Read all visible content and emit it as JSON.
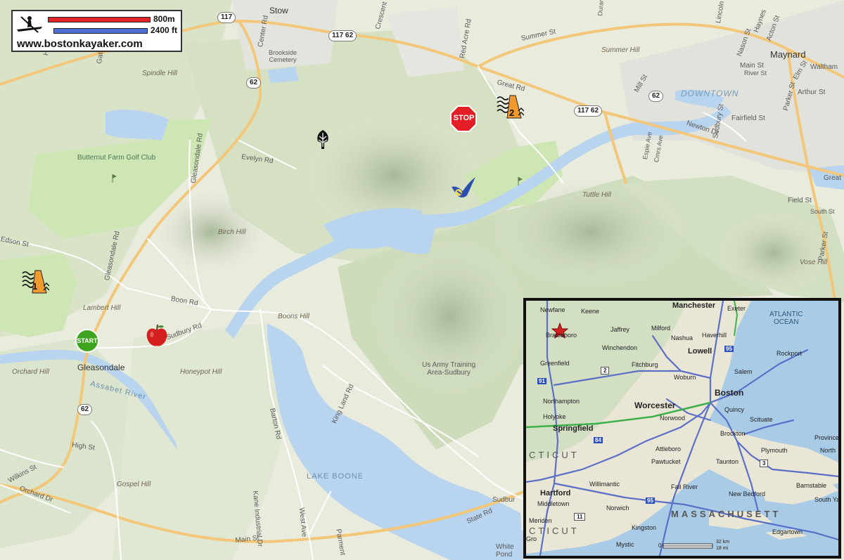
{
  "legend": {
    "scale_metric": "800m",
    "scale_imperial": "2400 ft",
    "website": "www.bostonkayaker.com",
    "kayak_icon": "kayaker-icon",
    "metric_bar_color": "#e0262b",
    "imperial_bar_color": "#4f6ed6"
  },
  "places": {
    "stow": "Stow",
    "maynard": "Maynard",
    "downtown": "DOWNTOWN",
    "gleasondale": "Gleasondale",
    "assabet_river": "Assabet River",
    "lake_boone": "LAKE BOONE",
    "army_area": "Us Army Training\nArea-Sudbury",
    "white_pond": "White\nPond",
    "cemetery": "Brookside\nCemetery",
    "golf_club": "Butternut Farm Golf Club"
  },
  "hills": [
    "Spindle Hill",
    "Summer Hill",
    "Birch Hill",
    "Lambert Hill",
    "Boons Hill",
    "Orchard Hill",
    "Honeypot Hill",
    "Gospel Hill",
    "Tuttle Hill",
    "Vose Hill"
  ],
  "roads": {
    "summer_st": "Summer St",
    "great_rd": "Great Rd",
    "great_rd_east": "Great",
    "red_acre_rd": "Red Acre Rd",
    "crescent_st": "Crescent St",
    "gleasondale_rd_n": "Gleasondale Rd",
    "gleasondale_rd_s": "Gleasondale Rd",
    "evelyn_rd": "Evelyn Rd",
    "edson_st": "Edson St",
    "boon_rd": "Boon Rd",
    "sudbury_rd": "Sudbury Rd",
    "barton_rd": "Barton Rd",
    "king_land_rd": "King Land Rd",
    "kane_industrial_dr": "Kane Industrial Dr",
    "west_ave": "West Ave",
    "parmenter": "Parment",
    "main_st": "Main St",
    "high_st": "High St",
    "wilkins_st": "Wilkins St",
    "orchard_dr": "Orchard Dr",
    "state_rd": "State Rd",
    "sudbury_east": "Sudbur",
    "gates_ln": "Gates Ln",
    "hudson": "Huds",
    "center_rd": "Center Rd",
    "lincoln_st": "Lincoln St",
    "haynes": "Haynes",
    "acton_st": "Acton St",
    "nason_st": "Nason St",
    "main_st_maynard": "Main St",
    "river_st": "River St",
    "waltham": "Waltham",
    "elm_st": "Elm St",
    "arthur_st": "Arthur St",
    "parker_st": "Parker St",
    "parker_st_s": "Parker St",
    "mill_st": "Mill St",
    "newton_dr": "Newton Dr",
    "sudbury_st": "Sudbury St",
    "fairfield_st": "Fairfield St",
    "field_st": "Field St",
    "south_st": "South St",
    "espie_ave": "Espie Ave",
    "concord_st": "Cmrs Ave",
    "durant": "Durant"
  },
  "shields": {
    "r117_top": "117",
    "r117_62": "117 62",
    "r62_a": "62",
    "r62_b": "62",
    "r62_maynard": "62",
    "r117_62_east": "117 62"
  },
  "markers": {
    "start_label": "START",
    "stop_label": "STOP",
    "launch1_label": "1",
    "launch2_label": "2"
  },
  "inset": {
    "cities": [
      "Manchester",
      "Keene",
      "Exeter",
      "Jaffrey",
      "Milford",
      "Haverhill",
      "Newfane",
      "Brattleboro",
      "Nashua",
      "Winchendon",
      "Lowell",
      "Rockport",
      "Greenfield",
      "Fitchburg",
      "Salem",
      "Woburn",
      "Boston",
      "Northampton",
      "Worcester",
      "Quincy",
      "Holyoke",
      "Norwood",
      "Scituate",
      "Springfield",
      "Brockton",
      "Province",
      "Plymouth",
      "North",
      "Attleboro",
      "Pawtucket",
      "Taunton",
      "Hartford",
      "Willimantic",
      "Fall River",
      "New Bedford",
      "Barnstable",
      "Middletown",
      "Norwich",
      "South Ya",
      "Meriden",
      "Kingston",
      "Edgartown",
      "Mystic",
      "Gro"
    ],
    "states": {
      "ct_top": "CTICUT",
      "ct_bottom": "CTICUT",
      "ma": "MASSACHUSETT"
    },
    "ocean": "ATLANTIC\nOCEAN",
    "highways": [
      "95",
      "91",
      "2",
      "84",
      "3",
      "11",
      "95"
    ],
    "scale_0": "0",
    "scale_km": "32 km",
    "scale_mi": "18 mi",
    "star_color": "#d42020"
  }
}
